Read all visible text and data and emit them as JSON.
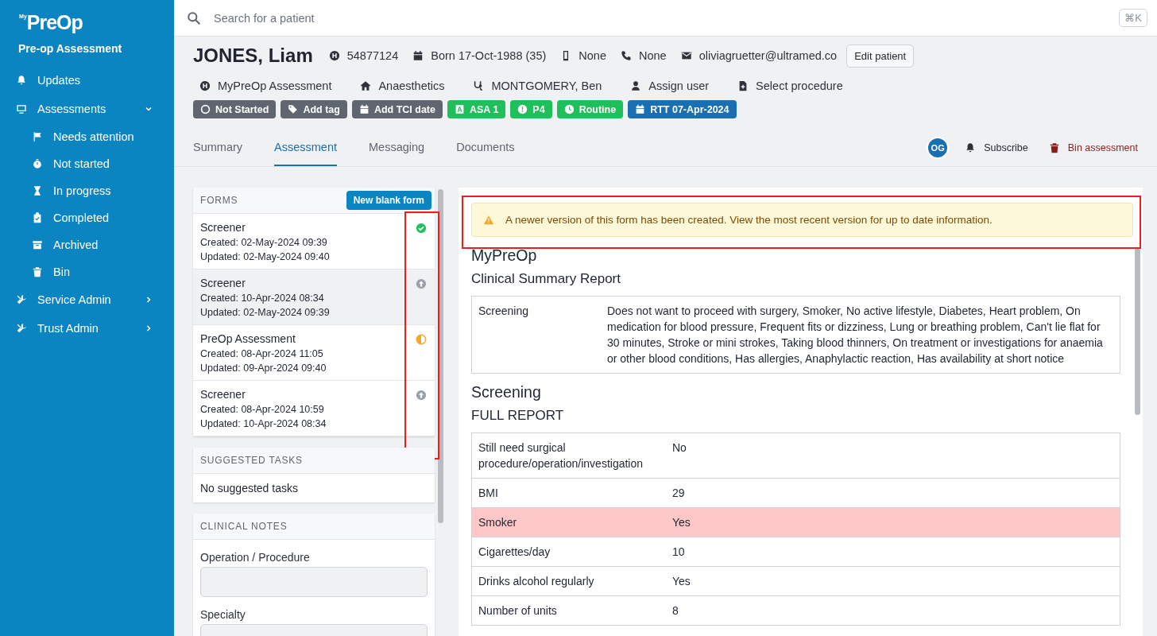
{
  "sidebar": {
    "logo_small": "My",
    "logo": "PreOp",
    "subtitle": "Pre-op Assessment",
    "items": [
      {
        "label": "Updates"
      },
      {
        "label": "Assessments",
        "expanded": true,
        "children": [
          {
            "label": "Needs attention"
          },
          {
            "label": "Not started"
          },
          {
            "label": "In progress"
          },
          {
            "label": "Completed"
          },
          {
            "label": "Archived"
          },
          {
            "label": "Bin"
          }
        ]
      },
      {
        "label": "Service Admin",
        "expanded": false
      },
      {
        "label": "Trust Admin",
        "expanded": false
      }
    ]
  },
  "search": {
    "placeholder": "Search for a patient",
    "shortcut": "⌘K"
  },
  "patient": {
    "name": "JONES, Liam",
    "hospital_number": "54877124",
    "born": "Born 17-Oct-1988 (35)",
    "mobile": "None",
    "phone": "None",
    "email": "oliviagruetter@ultramed.co",
    "edit_button": "Edit patient"
  },
  "details": [
    "MyPreOp Assessment",
    "Anaesthetics",
    "MONTGOMERY, Ben",
    "Assign user",
    "Select procedure"
  ],
  "tags": [
    {
      "label": "Not Started",
      "color": "#5f6670"
    },
    {
      "label": "Add tag",
      "color": "#5f6670"
    },
    {
      "label": "Add TCI date",
      "color": "#5f6670"
    },
    {
      "label": "ASA 1",
      "color": "#1fbf5b"
    },
    {
      "label": "P4",
      "color": "#1fbf5b"
    },
    {
      "label": "Routine",
      "color": "#1fbf5b"
    },
    {
      "label": "RTT 07-Apr-2024",
      "color": "#1a6fb0"
    }
  ],
  "tabs": [
    {
      "label": "Summary",
      "selected": false
    },
    {
      "label": "Assessment",
      "selected": true
    },
    {
      "label": "Messaging",
      "selected": false
    },
    {
      "label": "Documents",
      "selected": false
    }
  ],
  "actions": {
    "avatar": "OG",
    "subscribe": "Subscribe",
    "bin": "Bin assessment"
  },
  "forms": {
    "title": "FORMS",
    "new_button": "New blank form",
    "status_column_highlighted": true,
    "items": [
      {
        "name": "Screener",
        "created": "Created: 02-May-2024 09:39",
        "updated": "Updated: 02-May-2024 09:40",
        "kind": "complete",
        "selected": false
      },
      {
        "name": "Screener",
        "created": "Created: 10-Apr-2024 08:34",
        "updated": "Updated: 02-May-2024 09:39",
        "kind": "superseded",
        "selected": true
      },
      {
        "name": "PreOp Assessment",
        "created": "Created: 08-Apr-2024 11:05",
        "updated": "Updated: 09-Apr-2024 09:40",
        "kind": "in_progress",
        "selected": false
      },
      {
        "name": "Screener",
        "created": "Created: 08-Apr-2024 10:59",
        "updated": "Updated: 10-Apr-2024 08:34",
        "kind": "superseded",
        "selected": false
      }
    ]
  },
  "suggested_tasks": {
    "title": "SUGGESTED TASKS",
    "text": "No suggested tasks"
  },
  "clinical_notes": {
    "title": "CLINICAL NOTES",
    "fields": [
      {
        "label": "Operation / Procedure"
      },
      {
        "label": "Specialty"
      }
    ]
  },
  "report": {
    "alert": "A newer version of this form has been created. View the most recent version for up to date information.",
    "alert_highlighted": true,
    "title": "MyPreOp",
    "subtitle": "Clinical Summary Report",
    "summary": [
      {
        "label": "Screening",
        "value": "Does not want to proceed with surgery, Smoker, No active lifestyle, Diabetes, Heart problem, On medication for blood pressure, Frequent fits or dizziness, Lung or breathing problem, Can't lie flat for 30 minutes, Stroke or mini strokes, Taking blood thinners, On treatment or investigations for anaemia or other blood conditions, Has allergies, Anaphylactic reaction, Has availability at short notice"
      }
    ],
    "section": "Screening",
    "section_subtitle": "FULL REPORT",
    "rows": [
      {
        "label": "Still need surgical procedure/operation/investigation",
        "value": "No",
        "flagged": false
      },
      {
        "label": "BMI",
        "value": "29",
        "flagged": false
      },
      {
        "label": "Smoker",
        "value": "Yes",
        "flagged": true
      },
      {
        "label": "Cigarettes/day",
        "value": "10",
        "flagged": false
      },
      {
        "label": "Drinks alcohol regularly",
        "value": "Yes",
        "flagged": false
      },
      {
        "label": "Number of units",
        "value": "8",
        "flagged": false
      }
    ]
  }
}
